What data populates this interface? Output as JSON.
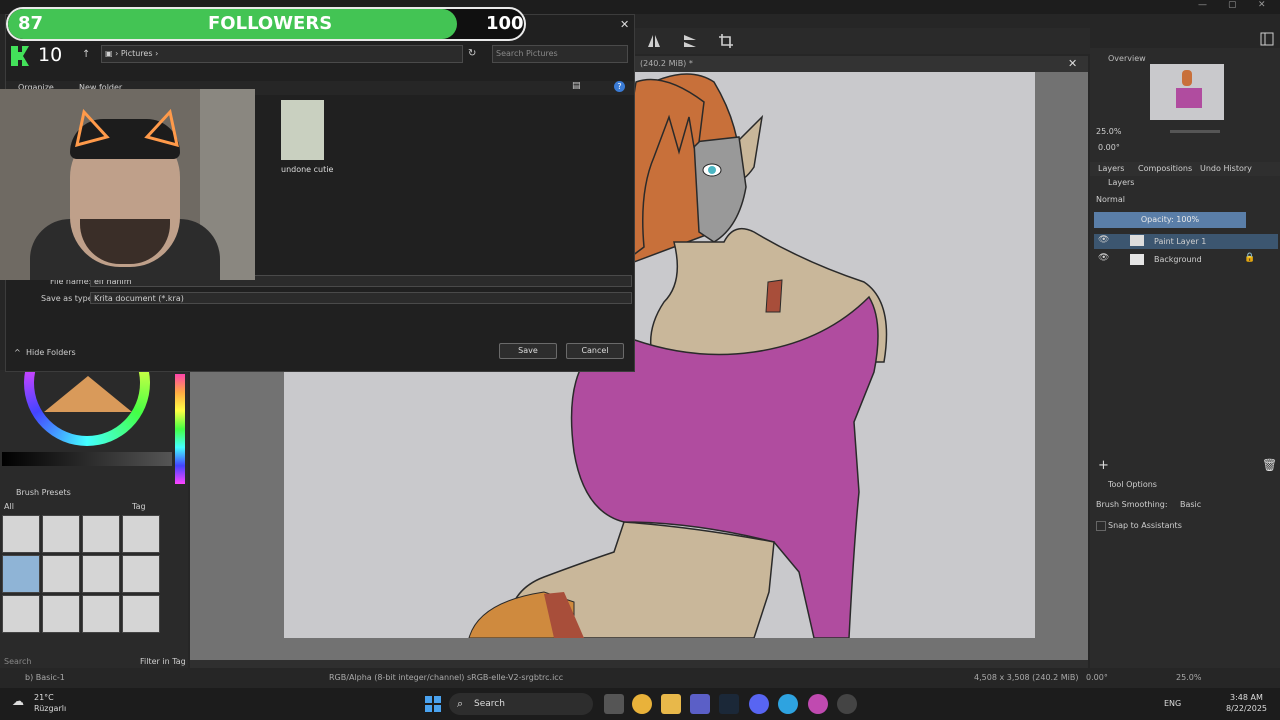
{
  "window": {
    "minimize": "—",
    "maximize": "▢",
    "close": "✕"
  },
  "document_tab": {
    "title": "(240.2 MiB) *"
  },
  "overlay": {
    "followers_current": "87",
    "followers_label": "FOLLOWERS",
    "followers_goal": "100",
    "followers_progress": 0.87,
    "kick_count": "10"
  },
  "dialog": {
    "breadcrumb_root": "Pictures",
    "search_placeholder": "Search Pictures",
    "organize_label": "Organize",
    "new_folder_label": "New folder",
    "file_item_label": "undone cutie",
    "file_name_label": "File name:",
    "file_name_value": "elf hanim",
    "save_as_type_label": "Save as type:",
    "save_as_type_value": "Krita document (*.kra)",
    "hide_folders_label": "Hide Folders",
    "save_label": "Save",
    "cancel_label": "Cancel",
    "close_label": "✕"
  },
  "right_dock": {
    "overview_title": "Overview",
    "zoom_value": "25.0%",
    "rotation_value": "0.00°",
    "tabs": [
      "Layers",
      "Compositions",
      "Undo History"
    ],
    "layers_title": "Layers",
    "blend_mode": "Normal",
    "opacity_label": "Opacity: 100%",
    "layers": [
      {
        "name": "Paint Layer 1"
      },
      {
        "name": "Background"
      }
    ],
    "tool_options_title": "Tool Options",
    "brush_smoothing_label": "Brush Smoothing:",
    "brush_smoothing_value": "Basic",
    "snap_label": "Snap to Assistants"
  },
  "left_panel": {
    "brush_presets_title": "Brush Presets",
    "filter_all": "All",
    "tag_label": "Tag",
    "search_placeholder": "Search",
    "filter_in_tag": "Filter in Tag"
  },
  "status_bar": {
    "brush_name": "b) Basic-1",
    "color_profile": "RGB/Alpha (8-bit integer/channel)  sRGB-elle-V2-srgbtrc.icc",
    "dimensions": "4,508 x 3,508 (240.2 MiB)",
    "rotation": "0.00°",
    "zoom": "25.0%"
  },
  "taskbar": {
    "weather_temp": "21°C",
    "weather_desc": "Rüzgarlı",
    "search_label": "Search",
    "language": "ENG",
    "time": "3:48 AM",
    "date": "8/22/2025"
  },
  "colors": {
    "accent_green": "#43c454",
    "shirt": "#b04c9f",
    "hair": "#c8703a",
    "skin": "#c9b79a"
  }
}
